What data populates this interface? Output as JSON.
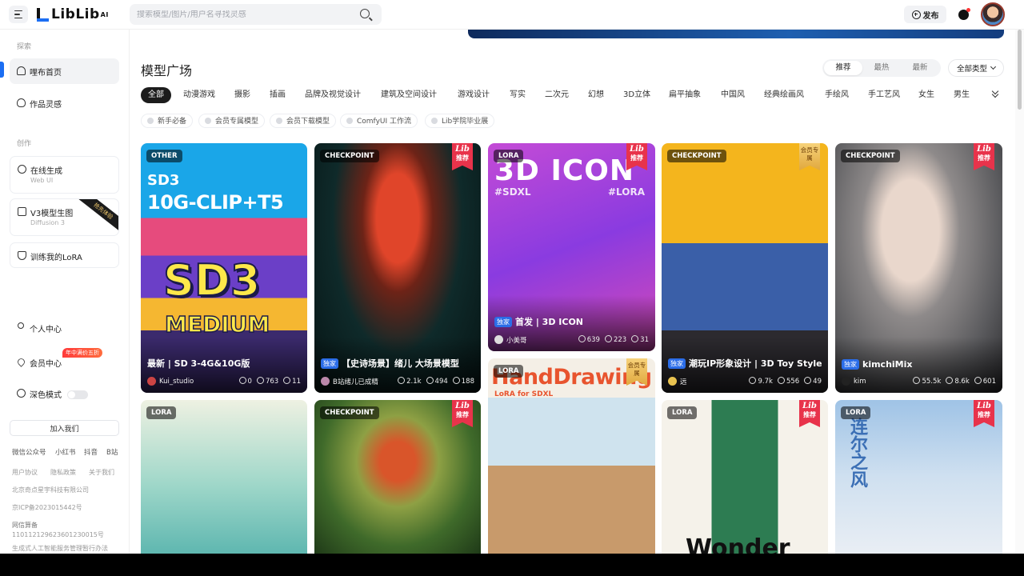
{
  "header": {
    "logo_text": "LibLib",
    "logo_sup": "AI",
    "search_placeholder": "搜索模型/图片/用户名寻找灵感",
    "publish_label": "发布"
  },
  "sidebar": {
    "explore_label": "探索",
    "create_label": "创作",
    "items": [
      {
        "label": "哩布首页"
      },
      {
        "label": "作品灵感"
      }
    ],
    "create_items": [
      {
        "label": "在线生成",
        "sub": "Web UI"
      },
      {
        "label": "V3模型生图",
        "sub": "Diffusion 3",
        "ribbon": "抢先体验"
      },
      {
        "label": "训练我的LoRA"
      }
    ],
    "account_items": [
      {
        "label": "个人中心"
      },
      {
        "label": "会员中心",
        "badge": "年中满价五折"
      },
      {
        "label": "深色模式"
      }
    ],
    "join_label": "加入我们",
    "social": [
      "微信公众号",
      "小红书",
      "抖音",
      "B站"
    ],
    "footer_links": [
      "用户协议",
      "隐私政策",
      "关于我们"
    ],
    "company": "北京奇点星宇科技有限公司",
    "icp": "京ICP备2023015442号",
    "police_title": "网信算备",
    "police_no": "110112129623601230015号",
    "ai_notice": "生成式人工智能服务管理暂行办法"
  },
  "main": {
    "title": "模型广场",
    "sort_tabs": [
      "推荐",
      "最热",
      "最新"
    ],
    "type_select": "全部类型",
    "categories": [
      "全部",
      "动漫游戏",
      "摄影",
      "插画",
      "品牌及视觉设计",
      "建筑及空间设计",
      "游戏设计",
      "写实",
      "二次元",
      "幻想",
      "3D立体",
      "扁平抽象",
      "中国风",
      "经典绘画风",
      "手绘风",
      "手工艺风",
      "女生",
      "男生"
    ],
    "tags": [
      "新手必备",
      "会员专属模型",
      "会员下载模型",
      "ComfyUI 工作流",
      "Lib学院毕业展"
    ]
  },
  "cards": [
    {
      "type": "OTHER",
      "title": "最新 | SD 3-4G&10G版",
      "author": "Kui_studio",
      "runs": "0",
      "downloads": "763",
      "comments": "11",
      "big1": "SD3",
      "big2": "10G-CLIP+T5",
      "big3": "SD3",
      "big4": "MEDIUM"
    },
    {
      "type": "CHECKPOINT",
      "lib": "Lib",
      "lib_sub": "推荐",
      "exclusive": "独家",
      "title": "【史诗场景】绪儿 大场景模型",
      "author": "B站绪儿已成精",
      "runs": "2.1k",
      "downloads": "494",
      "comments": "188"
    },
    {
      "type": "LORA",
      "lib": "Lib",
      "lib_sub": "推荐",
      "exclusive": "独家",
      "title": "首发 | 3D ICON",
      "author": "小美哥",
      "runs": "639",
      "downloads": "223",
      "comments": "31",
      "big1": "3D ICON",
      "big2": "#SDXL",
      "big3": "#LORA"
    },
    {
      "type": "CHECKPOINT",
      "vip": "会员专属",
      "exclusive": "独家",
      "title": "潮玩IP形象设计 | 3D Toy Style",
      "author": "远",
      "runs": "9.7k",
      "downloads": "556",
      "comments": "49"
    },
    {
      "type": "CHECKPOINT",
      "lib": "Lib",
      "lib_sub": "推荐",
      "exclusive": "独家",
      "title": "kimchiMix",
      "author": "kim",
      "runs": "55.5k",
      "downloads": "8.6k",
      "comments": "601"
    },
    {
      "type": "LORA"
    },
    {
      "type": "CHECKPOINT",
      "lib": "Lib",
      "lib_sub": "推荐"
    },
    {
      "type": "LORA",
      "vip": "会员专属",
      "big1": "HandDrawing",
      "big2": "LoRA for SDXL"
    },
    {
      "type": "LORA",
      "lib": "Lib",
      "lib_sub": "推荐",
      "big1": "Wonder"
    },
    {
      "type": "LORA",
      "lib": "Lib",
      "lib_sub": "推荐",
      "big1": "连尔之风"
    }
  ]
}
